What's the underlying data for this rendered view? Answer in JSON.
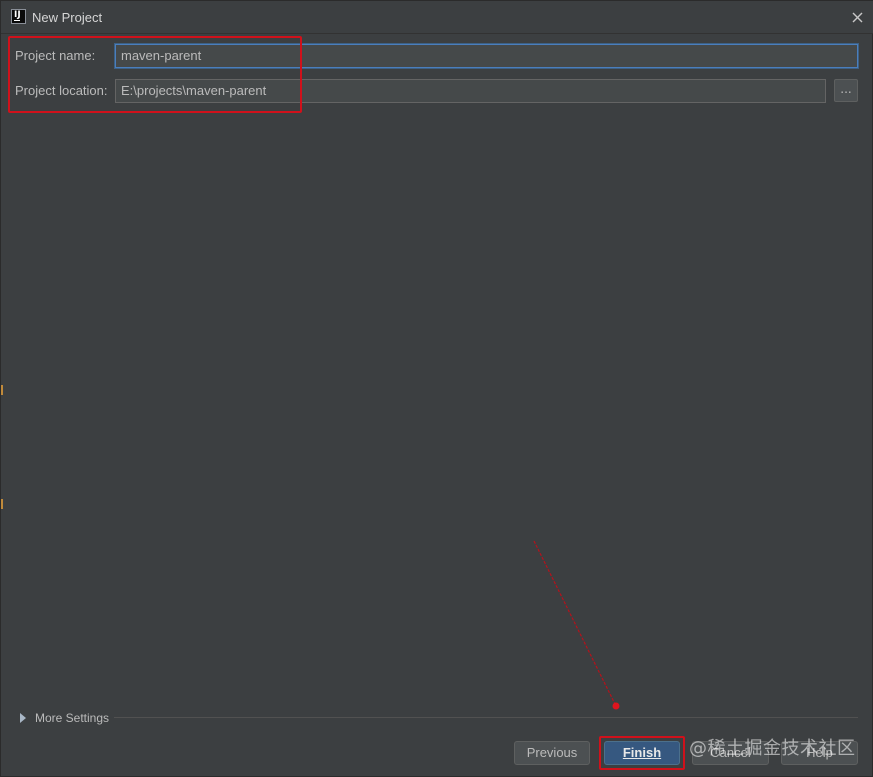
{
  "window": {
    "title": "New Project",
    "app_icon": "intellij-icon",
    "close_icon": "close-icon"
  },
  "form": {
    "project_name_label": "Project name:",
    "project_name_value": "maven-parent",
    "project_location_label": "Project location:",
    "project_location_value": "E:\\projects\\maven-parent",
    "browse_label": "..."
  },
  "more_settings": {
    "label": "More Settings",
    "icon": "expand-triangle-icon"
  },
  "buttons": {
    "previous": "Previous",
    "finish": "Finish",
    "cancel": "Cancel",
    "help": "Help"
  },
  "annotations": {
    "highlight_color": "#d0111b"
  },
  "watermark": {
    "text": "@稀土掘金技术社区"
  },
  "colors": {
    "background": "#3c3f41",
    "primary_button": "#365880",
    "focus_border": "#4a7ebd"
  }
}
